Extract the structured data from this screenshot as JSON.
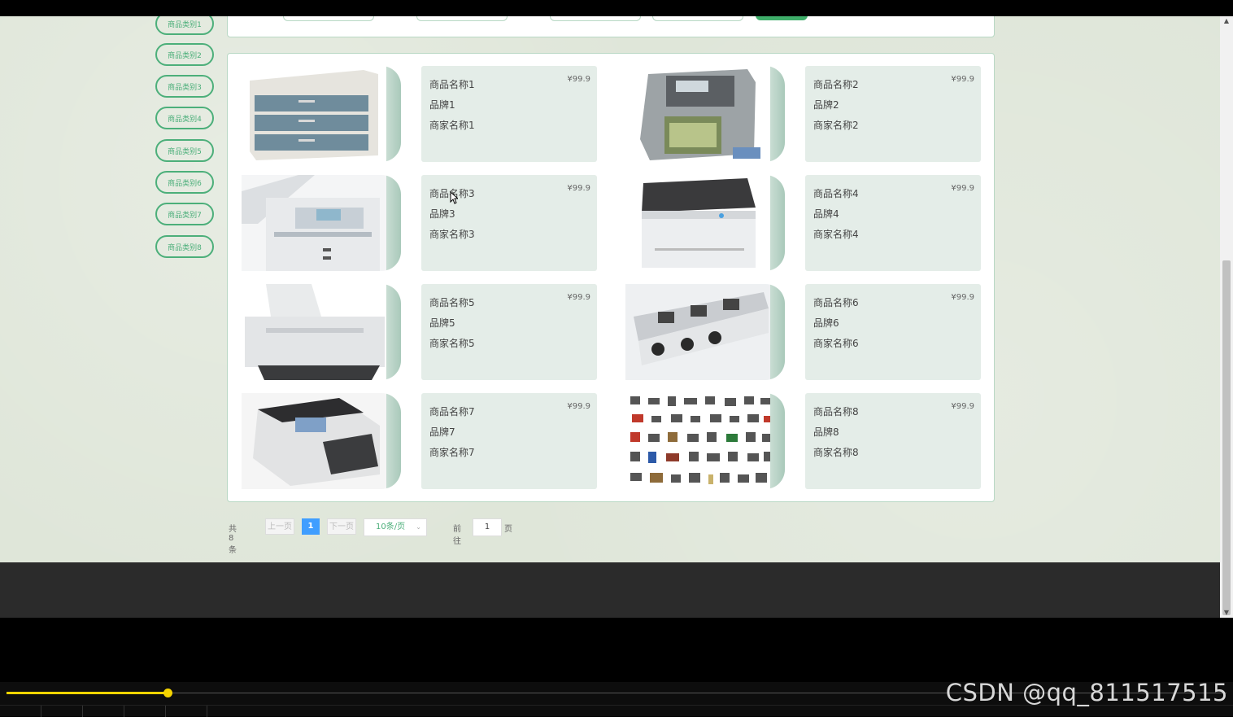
{
  "categories": [
    "商品类别1",
    "商品类别2",
    "商品类别3",
    "商品类别4",
    "商品类别5",
    "商品类别6",
    "商品类别7",
    "商品类别8"
  ],
  "products": [
    {
      "name": "商品名称1",
      "brand": "品牌1",
      "merchant": "商家名称1",
      "price": "¥99.9",
      "icon": "file-cabinet-image"
    },
    {
      "name": "商品名称2",
      "brand": "品牌2",
      "merchant": "商家名称2",
      "price": "¥99.9",
      "icon": "money-counter-image"
    },
    {
      "name": "商品名称3",
      "brand": "品牌3",
      "merchant": "商家名称3",
      "price": "¥99.9",
      "icon": "copier-image"
    },
    {
      "name": "商品名称4",
      "brand": "品牌4",
      "merchant": "商家名称4",
      "price": "¥99.9",
      "icon": "laser-printer-image"
    },
    {
      "name": "商品名称5",
      "brand": "品牌5",
      "merchant": "商家名称5",
      "price": "¥99.9",
      "icon": "inkjet-printer-image"
    },
    {
      "name": "商品名称6",
      "brand": "品牌6",
      "merchant": "商家名称6",
      "price": "¥99.9",
      "icon": "office-desks-image"
    },
    {
      "name": "商品名称7",
      "brand": "品牌7",
      "merchant": "商家名称7",
      "price": "¥99.9",
      "icon": "bill-counter-image"
    },
    {
      "name": "商品名称8",
      "brand": "品牌8",
      "merchant": "商家名称8",
      "price": "¥99.9",
      "icon": "office-supplies-collage-image"
    }
  ],
  "pagination": {
    "total": "共 8 条",
    "prev": "上一页",
    "current": "1",
    "next": "下一页",
    "page_size": "10条/页",
    "goto_label": "前往",
    "goto_value": "1",
    "goto_unit": "页"
  },
  "player": {
    "progress": 0.132
  },
  "watermark": "CSDN @qq_811517515",
  "colors": {
    "accent": "#4caf7a",
    "page_bg": "#dfe6d9",
    "card_bg": "#e4ede8",
    "current_page": "#409eff",
    "progress": "#f5d400"
  }
}
